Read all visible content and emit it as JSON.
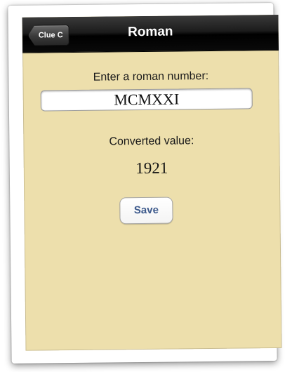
{
  "navbar": {
    "back_label": "Clue C",
    "title": "Roman"
  },
  "form": {
    "prompt_label": "Enter a roman number:",
    "roman_input_value": "MCMXXI",
    "converted_label": "Converted value:",
    "converted_value": "1921",
    "save_label": "Save"
  },
  "colors": {
    "background": "#eddfac",
    "navbar": "#000000",
    "save_text": "#3d5a8c"
  }
}
